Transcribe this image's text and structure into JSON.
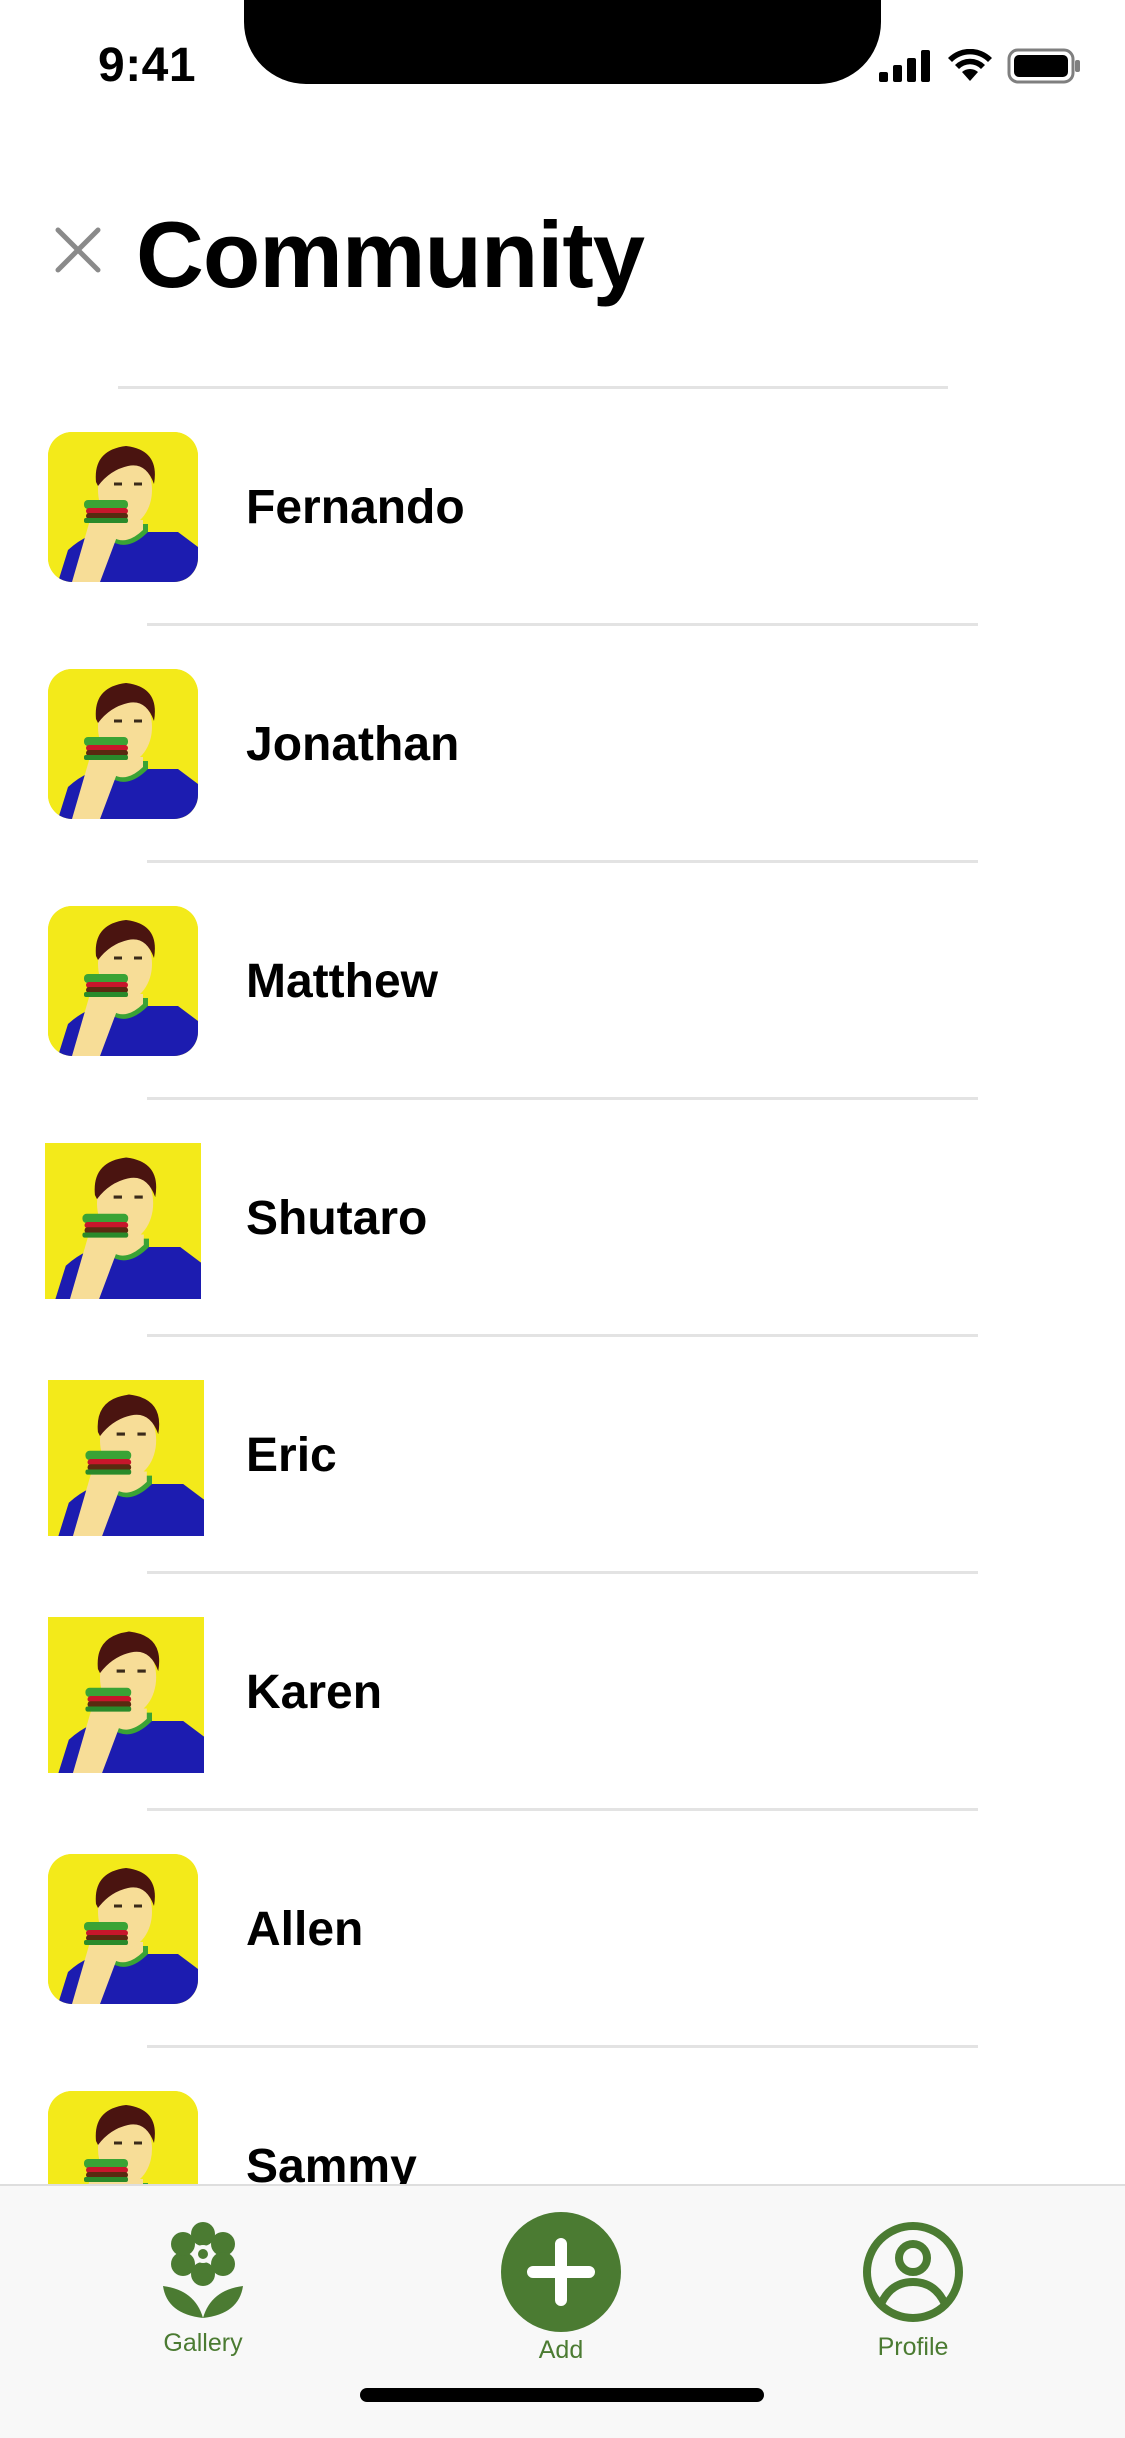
{
  "status_bar": {
    "time": "9:41"
  },
  "header": {
    "title": "Community",
    "close_icon": "close-icon"
  },
  "community": {
    "members": [
      {
        "name": "Fernando"
      },
      {
        "name": "Jonathan"
      },
      {
        "name": "Matthew"
      },
      {
        "name": "Shutaro"
      },
      {
        "name": "Eric"
      },
      {
        "name": "Karen"
      },
      {
        "name": "Allen"
      },
      {
        "name": "Sammy"
      }
    ]
  },
  "tabbar": {
    "gallery": {
      "label": "Gallery",
      "icon": "flower-icon"
    },
    "add": {
      "label": "Add",
      "icon": "plus-icon"
    },
    "profile": {
      "label": "Profile",
      "icon": "person-circle-icon"
    }
  },
  "colors": {
    "accent": "#4b7b32",
    "avatar_bg": "#f3ea1a",
    "avatar_shirt": "#1c1cb0"
  }
}
